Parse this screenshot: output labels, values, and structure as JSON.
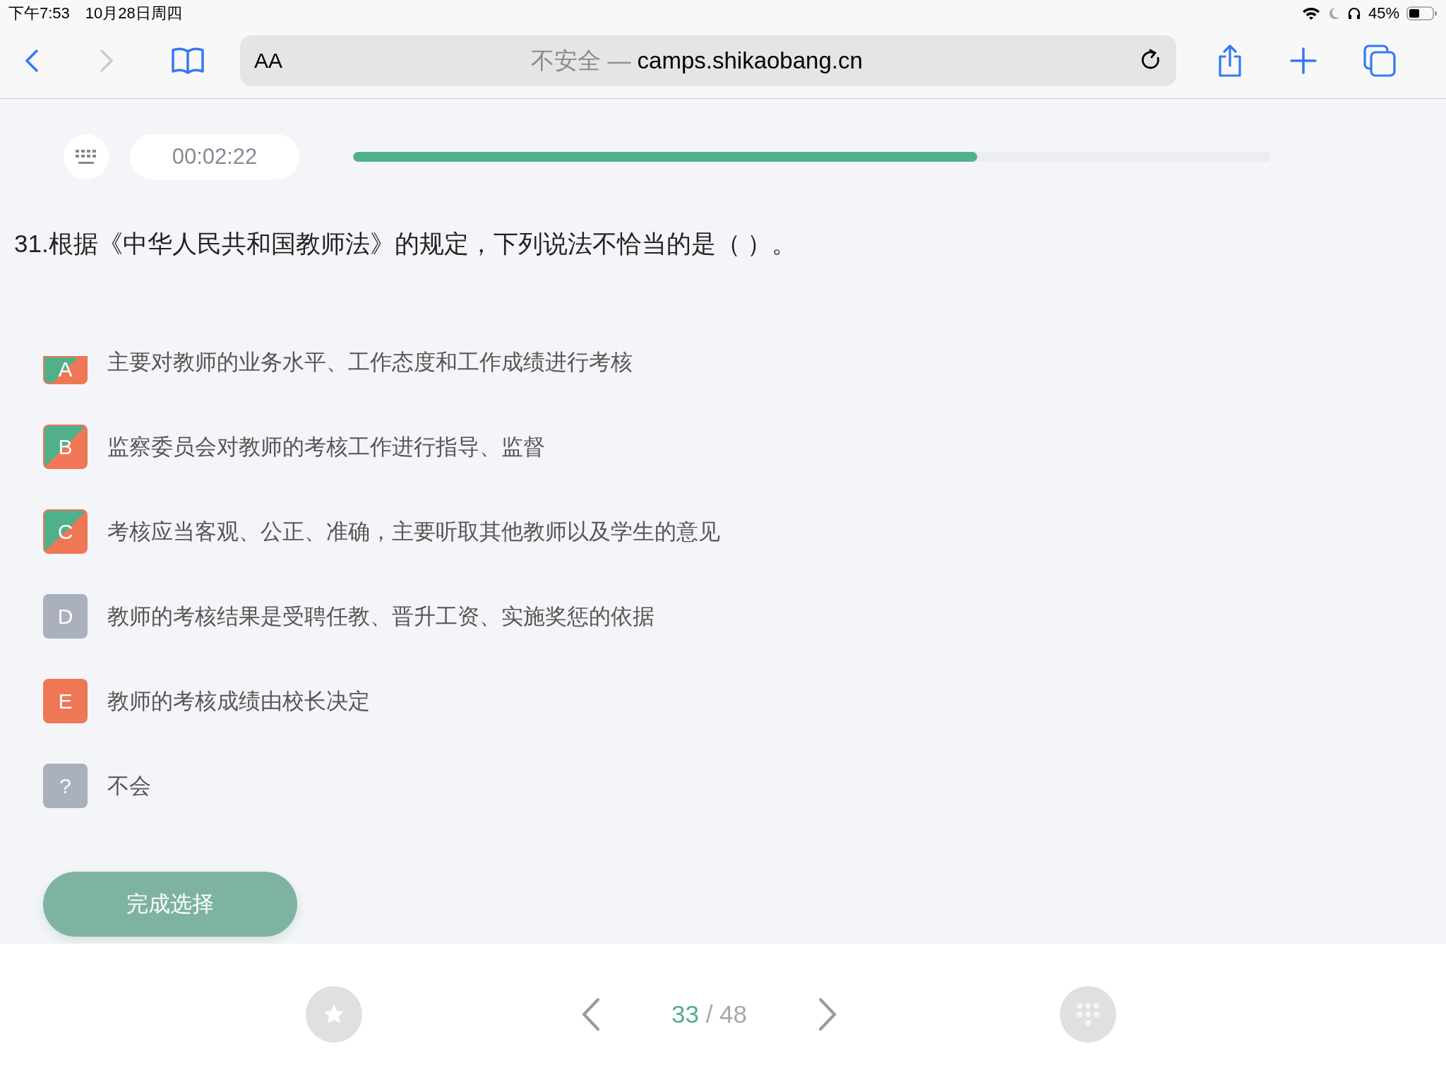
{
  "status_bar": {
    "time": "下午7:53",
    "date": "10月28日周四",
    "battery": "45%"
  },
  "browser": {
    "text_size_button": "AA",
    "security": "不安全 —",
    "url": "camps.shikaobang.cn",
    "back_enabled": true,
    "forward_enabled": false
  },
  "timer": "00:02:22",
  "progress": {
    "level": 0.68
  },
  "question": "31.根据《中华人民共和国教师法》的规定，下列说法不恰当的是（ ）。",
  "options": [
    {
      "letter": "A",
      "text": "主要对教师的业务水平、工作态度和工作成绩进行考核",
      "kind": "split",
      "clipped": true
    },
    {
      "letter": "B",
      "text": "监察委员会对教师的考核工作进行指导、监督",
      "kind": "split",
      "clipped": false
    },
    {
      "letter": "C",
      "text": "考核应当客观、公正、准确，主要听取其他教师以及学生的意见",
      "kind": "split",
      "clipped": false
    },
    {
      "letter": "D",
      "text": "教师的考核结果是受聘任教、晋升工资、实施奖惩的依据",
      "kind": "grey",
      "clipped": false
    },
    {
      "letter": "E",
      "text": "教师的考核成绩由校长决定",
      "kind": "orange",
      "clipped": false
    },
    {
      "letter": "?",
      "text": "不会",
      "kind": "grey",
      "clipped": false
    }
  ],
  "submit_button": "完成选择",
  "pager": {
    "current": "33",
    "total": "/ 48"
  }
}
